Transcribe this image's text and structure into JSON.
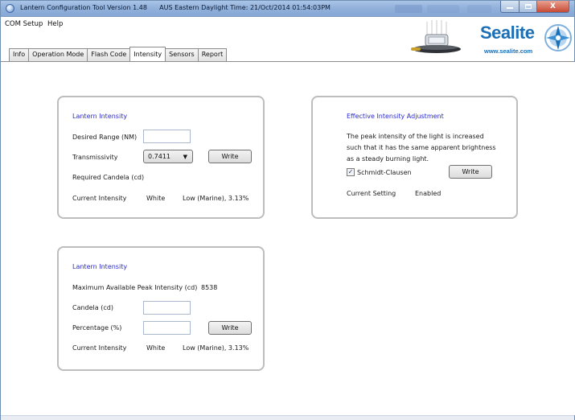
{
  "window": {
    "title": "Lantern Configuration Tool Version 1.48",
    "time_label": "AUS Eastern Daylight Time: 21/Oct/2014 01:54:03PM",
    "controls": {
      "minimize": "minimize",
      "maximize": "maximize",
      "close": "X"
    }
  },
  "menu": {
    "items": [
      "COM Setup",
      "Help"
    ]
  },
  "tabs": [
    "Info",
    "Operation Mode",
    "Flash Code",
    "Intensity",
    "Sensors",
    "Report"
  ],
  "active_tab": "Intensity",
  "logo": {
    "name": "Sealite",
    "url": "www.sealite.com",
    "brand_color": "#1c6fb5"
  },
  "panel1": {
    "title": "Lantern Intensity",
    "desired_range_label": "Desired Range (NM)",
    "desired_range_value": "",
    "transmissivity_label": "Transmissivity",
    "transmissivity_value": "0.7411",
    "write_label": "Write",
    "required_candela_label": "Required Candela (cd)",
    "current_intensity_label": "Current Intensity",
    "current_color": "White",
    "current_value": "Low (Marine), 3.13%"
  },
  "panel2": {
    "title": "Effective Intensity Adjustment",
    "desc_line1": "The peak intensity of the light is increased",
    "desc_line2": "such that it has the same apparent brightness",
    "desc_line3": "as a steady burning light.",
    "checkbox_label": "Schmidt-Clausen",
    "checkbox_checked": true,
    "write_label": "Write",
    "current_setting_label": "Current Setting",
    "current_setting_value": "Enabled"
  },
  "panel3": {
    "title": "Lantern Intensity",
    "max_peak_label": "Maximum Available Peak Intensity (cd)",
    "max_peak_value": "8538",
    "candela_label": "Candela (cd)",
    "candela_value": "",
    "percentage_label": "Percentage (%)",
    "percentage_value": "",
    "write_label": "Write",
    "current_intensity_label": "Current Intensity",
    "current_color": "White",
    "current_value": "Low (Marine), 3.13%"
  },
  "colors": {
    "panel_title": "#2a2ad0",
    "panel_border": "#bdbdbd",
    "titlebar": "#93b2db"
  }
}
